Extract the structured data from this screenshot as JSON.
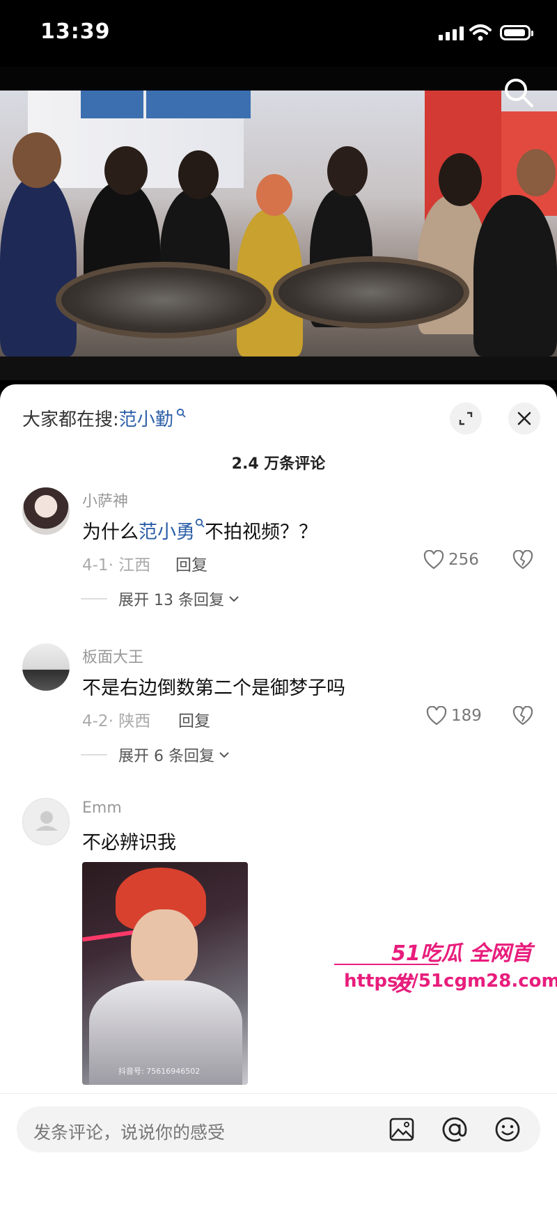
{
  "status": {
    "time": "13:39"
  },
  "panel": {
    "search_prefix": "大家都在搜:",
    "search_keyword": "范小勤",
    "comment_count": "2.4 万条评论"
  },
  "comments": [
    {
      "username": "小萨神",
      "text_prefix": "为什么",
      "text_keyword": "范小勇",
      "text_suffix": "不拍视频？？",
      "meta": "4-1· 江西",
      "reply_label": "回复",
      "likes": "256",
      "expand": "展开 13 条回复"
    },
    {
      "username": "板面大王",
      "text": "不是右边倒数第二个是御梦子吗",
      "meta": "4-2· 陕西",
      "reply_label": "回复",
      "likes": "189",
      "expand": "展开 6 条回复"
    },
    {
      "username": "Emm",
      "text": "不必辨识我",
      "image_watermark": "抖音号: 75616946502"
    }
  ],
  "watermark": {
    "line1": "51吃瓜 全网首发",
    "line2": "https://51cgm28.com"
  },
  "bottom": {
    "placeholder": "发条评论，说说你的感受"
  }
}
